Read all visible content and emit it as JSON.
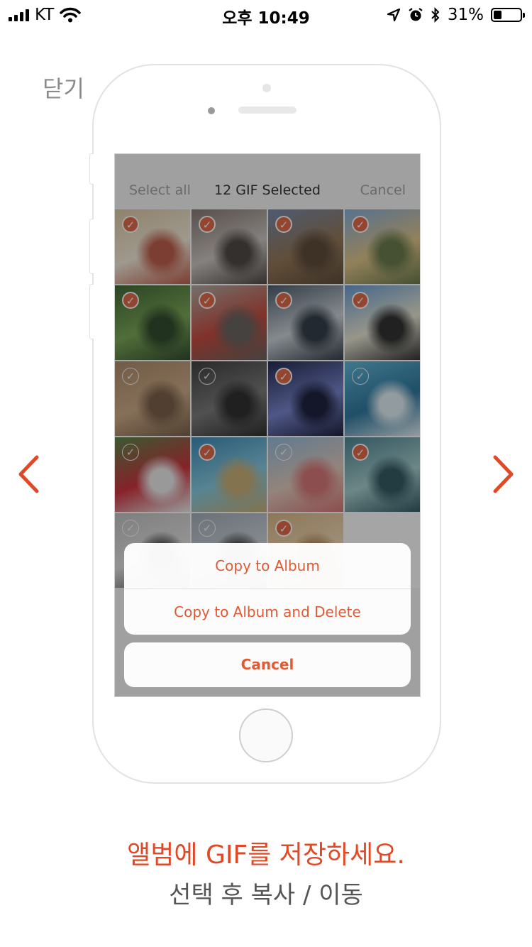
{
  "status_bar": {
    "carrier": "KT",
    "time": "오후 10:49",
    "battery_text": "31%",
    "battery_level": 0.31
  },
  "close_label": "닫기",
  "screen": {
    "nav": {
      "left": "Select all",
      "title": "12 GIF Selected",
      "right": "Cancel"
    },
    "photos": [
      {
        "selected": true,
        "colors": [
          "#d9c49c",
          "#f4ead7",
          "#b94e3a"
        ]
      },
      {
        "selected": true,
        "colors": [
          "#7a6b63",
          "#c8c2bd",
          "#3c3633"
        ]
      },
      {
        "selected": true,
        "colors": [
          "#6b7fa3",
          "#8a6a45",
          "#4e3a27"
        ]
      },
      {
        "selected": true,
        "colors": [
          "#7aa9d8",
          "#e0c080",
          "#5a6e3a"
        ]
      },
      {
        "selected": true,
        "colors": [
          "#2d5a22",
          "#6fa045",
          "#1c3a18"
        ]
      },
      {
        "selected": true,
        "colors": [
          "#a9a39b",
          "#c0392b",
          "#5a5550"
        ]
      },
      {
        "selected": true,
        "colors": [
          "#3d4d5c",
          "#c8d0d8",
          "#1f2a36"
        ]
      },
      {
        "selected": true,
        "colors": [
          "#5b93cf",
          "#e9e6d2",
          "#1d1d1d"
        ]
      },
      {
        "selected": false,
        "colors": [
          "#a7815d",
          "#c9a47b",
          "#6e5138"
        ]
      },
      {
        "selected": false,
        "colors": [
          "#2c2c2c",
          "#6e6e6e",
          "#1a1a1a"
        ]
      },
      {
        "selected": true,
        "colors": [
          "#0d1540",
          "#6a79c9",
          "#06092a"
        ]
      },
      {
        "selected": false,
        "colors": [
          "#4fb1d6",
          "#1a6a95",
          "#dfeef5"
        ]
      },
      {
        "selected": false,
        "colors": [
          "#4b7a3a",
          "#c81f2a",
          "#eaeaea"
        ]
      },
      {
        "selected": true,
        "colors": [
          "#2b7fb0",
          "#7ac6e0",
          "#c5a96a"
        ]
      },
      {
        "selected": false,
        "colors": [
          "#8ab6da",
          "#e0c7b8",
          "#d46a6a"
        ]
      },
      {
        "selected": true,
        "colors": [
          "#3a7a8a",
          "#9fc9c9",
          "#1f4a55"
        ]
      },
      {
        "selected": false,
        "colors": [
          "#bdbdbd",
          "#e0e0e0",
          "#3a3a3a"
        ]
      },
      {
        "selected": false,
        "colors": [
          "#9aa6b0",
          "#c7d0d8",
          "#2e2e2e"
        ]
      },
      {
        "selected": true,
        "colors": [
          "#d9b07a",
          "#f0d8b0",
          "#a87a4a"
        ]
      }
    ],
    "action_sheet": {
      "copy": "Copy to Album",
      "copy_delete": "Copy to Album and Delete",
      "cancel": "Cancel"
    }
  },
  "caption": {
    "main": "앨범에 GIF를 저장하세요.",
    "sub": "선택 후 복사 / 이동"
  },
  "colors": {
    "accent": "#e14926"
  }
}
